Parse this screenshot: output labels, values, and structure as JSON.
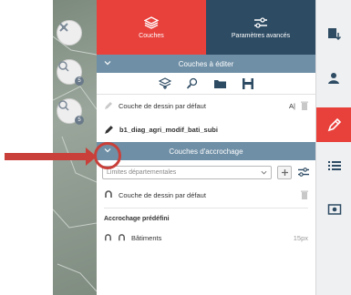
{
  "tabs": [
    {
      "label": "Couches",
      "icon": "layers-icon",
      "active": true
    },
    {
      "label": "Paramètres avancés",
      "icon": "sliders-icon",
      "active": false
    }
  ],
  "layers_section": {
    "title": "Couches à éditer",
    "default_layer": {
      "label": "Couche de dessin par défaut",
      "badge": "A|"
    },
    "selected_layer": {
      "label": "b1_diag_agri_modif_bati_subi"
    }
  },
  "snap_section": {
    "title": "Couches d'accrochage",
    "select_placeholder": "Limites départementales",
    "default_layer": {
      "label": "Couche de dessin par défaut"
    },
    "predefined": {
      "title": "Accrochage prédéfini",
      "items": [
        {
          "label": "Bâtiments",
          "value": "15px"
        }
      ]
    }
  },
  "map_controls": [
    {
      "icon": "close-tools-icon",
      "badge": ""
    },
    {
      "icon": "zoom-layer-icon",
      "badge": "5"
    },
    {
      "icon": "zoom-location-icon",
      "badge": "5"
    }
  ],
  "colors": {
    "accent": "#e8413c",
    "navy": "#2d4b63",
    "section": "#6f8fa6",
    "annotation": "#c9403a"
  }
}
